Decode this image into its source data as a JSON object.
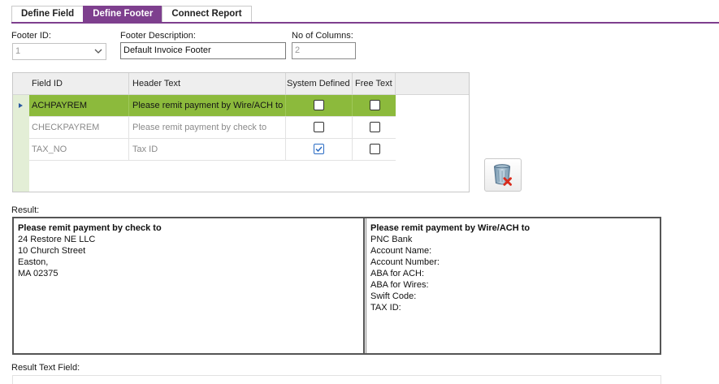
{
  "tabs": [
    {
      "label": "Define Field",
      "active": false
    },
    {
      "label": "Define Footer",
      "active": true
    },
    {
      "label": "Connect Report",
      "active": false
    }
  ],
  "colors": {
    "accent": "#7e3f8e",
    "selected_row": "#8cba3c",
    "row_header": "#e3eed6"
  },
  "form": {
    "footer_id_label": "Footer ID:",
    "footer_id_value": "1",
    "footer_desc_label": "Footer Description:",
    "footer_desc_value": "Default Invoice Footer",
    "columns_label": "No of Columns:",
    "columns_value": "2"
  },
  "grid": {
    "columns": [
      "Field ID",
      "Header Text",
      "System Defined",
      "Free Text"
    ],
    "rows": [
      {
        "field_id": "ACHPAYREM",
        "header_text": "Please remit payment by Wire/ACH to",
        "system_defined": false,
        "free_text": false,
        "selected": true
      },
      {
        "field_id": "CHECKPAYREM",
        "header_text": "Please remit payment by check to",
        "system_defined": false,
        "free_text": false,
        "selected": false
      },
      {
        "field_id": "TAX_NO",
        "header_text": "Tax ID",
        "system_defined": true,
        "free_text": false,
        "selected": false
      }
    ]
  },
  "delete_button_icon": "trash-delete-icon",
  "result": {
    "label": "Result:",
    "left": {
      "title": "Please remit payment by check to",
      "lines": [
        "24 Restore NE LLC",
        "10 Church Street",
        "Easton,",
        "MA 02375"
      ]
    },
    "right": {
      "title": "Please remit payment by Wire/ACH to",
      "lines": [
        "PNC Bank",
        "Account Name:",
        "Account Number:",
        "ABA for ACH:",
        "ABA for Wires:",
        "Swift Code:",
        "TAX ID:"
      ]
    }
  },
  "result_text_label": "Result Text Field:"
}
